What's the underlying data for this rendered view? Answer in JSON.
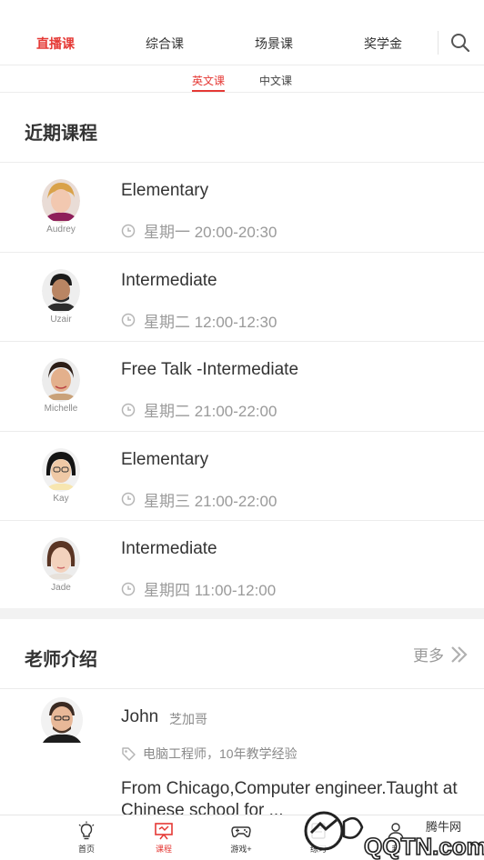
{
  "top_tabs": [
    {
      "label": "直播课",
      "active": true
    },
    {
      "label": "综合课",
      "active": false
    },
    {
      "label": "场景课",
      "active": false
    },
    {
      "label": "奖学金",
      "active": false
    }
  ],
  "sub_tabs": [
    {
      "label": "英文课",
      "active": true
    },
    {
      "label": "中文课",
      "active": false
    }
  ],
  "recent": {
    "title": "近期课程",
    "courses": [
      {
        "teacher": "Audrey",
        "title": "Elementary",
        "time": "星期一 20:00-20:30"
      },
      {
        "teacher": "Uzair",
        "title": "Intermediate",
        "time": "星期二 12:00-12:30"
      },
      {
        "teacher": "Michelle",
        "title": "Free Talk -Intermediate",
        "time": "星期二 21:00-22:00"
      },
      {
        "teacher": "Kay",
        "title": "Elementary",
        "time": "星期三 21:00-22:00"
      },
      {
        "teacher": "Jade",
        "title": "Intermediate",
        "time": "星期四 11:00-12:00"
      }
    ]
  },
  "teachers": {
    "title": "老师介绍",
    "more_label": "更多",
    "featured": {
      "name": "John",
      "chinese_name": "芝加哥",
      "tag": "电脑工程师，10年教学经验",
      "bio": "From Chicago,Computer engineer.Taught at Chinese school for ..."
    }
  },
  "bottom_nav": [
    {
      "label": "首页",
      "icon": "lightbulb-icon",
      "active": false
    },
    {
      "label": "课程",
      "icon": "presentation-icon",
      "active": true
    },
    {
      "label": "游戏+",
      "icon": "gamepad-icon",
      "active": false
    },
    {
      "label": "练习",
      "icon": "practice-icon",
      "active": false
    },
    {
      "label": "我",
      "icon": "person-icon",
      "active": false
    }
  ],
  "watermark": {
    "text_cn": "腾牛网",
    "text_en": "QQTN.com"
  },
  "colors": {
    "accent": "#e53935",
    "muted": "#9a9a9a",
    "text": "#333333",
    "divider": "#ececec"
  }
}
